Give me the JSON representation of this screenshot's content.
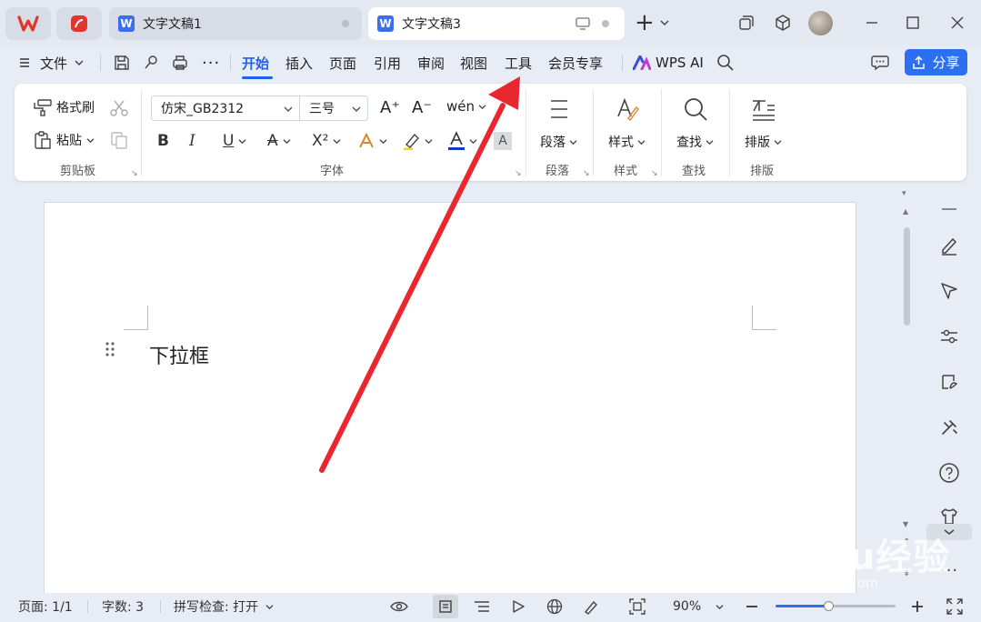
{
  "titlebar": {
    "tabs": [
      {
        "label": "文字文稿1",
        "icon": "word-doc-icon"
      },
      {
        "label": "文字文稿3",
        "icon": "word-doc-icon"
      }
    ],
    "doc_badge": "W",
    "new_tab": "+"
  },
  "menubar": {
    "file": "文件",
    "items": [
      "开始",
      "插入",
      "页面",
      "引用",
      "审阅",
      "视图",
      "工具",
      "会员专享"
    ],
    "active": "开始",
    "wps_ai": "WPS AI",
    "share": "分享"
  },
  "ribbon": {
    "clipboard": {
      "format_painter": "格式刷",
      "paste": "粘贴",
      "group": "剪贴板"
    },
    "font": {
      "font_name": "仿宋_GB2312",
      "font_size": "三号",
      "group": "字体",
      "bold": "B",
      "italic": "I",
      "underline": "U",
      "superscript": "X²"
    },
    "paragraph": {
      "label": "段落",
      "group": "段落"
    },
    "style": {
      "label": "样式",
      "group": "样式"
    },
    "find": {
      "label": "查找",
      "group": "查找"
    },
    "layout": {
      "label": "排版",
      "group": "排版"
    }
  },
  "document": {
    "text": "下拉框"
  },
  "statusbar": {
    "page": "页面: 1/1",
    "words": "字数: 3",
    "spell": "拼写检查: 打开",
    "zoom": "90%",
    "zoom_level": 0.44
  },
  "watermark": {
    "brand": "Baidu经验",
    "url": "jingyan.baidu.com"
  },
  "colors": {
    "accent": "#2162e8",
    "share_button": "#2c6ff1",
    "arrow": "#e8272f",
    "app_logo": "#e2352b"
  }
}
